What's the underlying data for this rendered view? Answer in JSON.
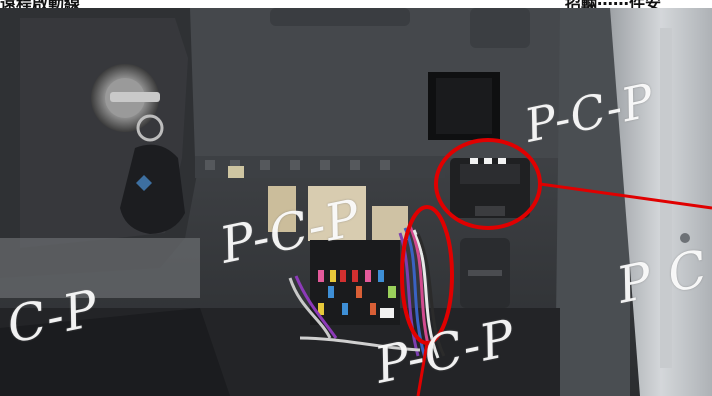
{
  "caption": {
    "left": "遠程啟動線",
    "right": "招輛⋯⋯件安"
  },
  "watermarks": [
    "P-C-P",
    "P-C-P",
    "C-P",
    "P-C-P",
    "P C"
  ],
  "icons": {
    "key": "car-key",
    "circle1": "red-highlight-circle",
    "circle2": "red-highlight-circle"
  },
  "colors": {
    "highlight": "#e00000",
    "dash": "#3a3d41",
    "fuse_box": "#1a1b1d",
    "door": "#b9bcbf"
  }
}
